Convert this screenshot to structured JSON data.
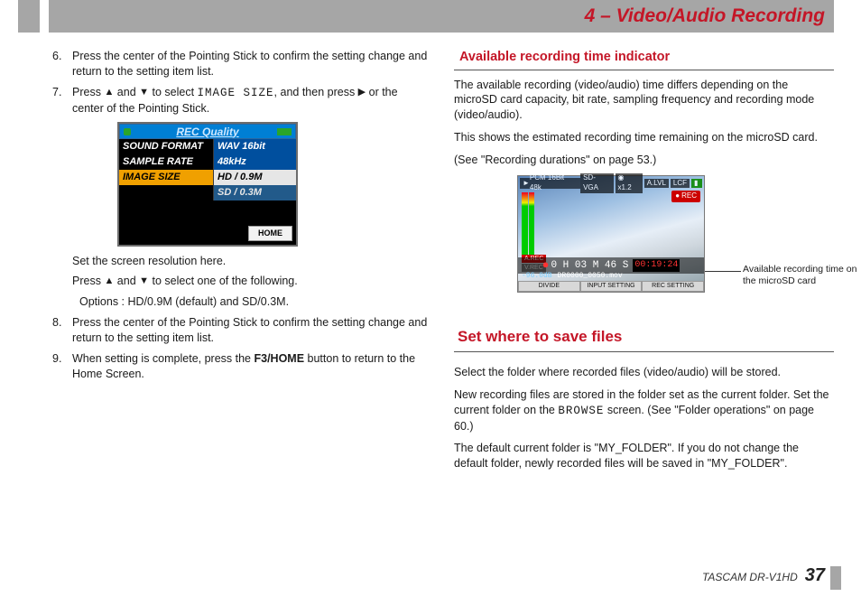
{
  "header": {
    "title": "4 – Video/Audio Recording"
  },
  "left": {
    "steps": {
      "s6": "Press the center of the Pointing Stick to confirm the setting change and return to the setting item list.",
      "s7_a": "Press ",
      "s7_b": " and ",
      "s7_c": " to select ",
      "s7_mono": "IMAGE SIZE",
      "s7_d": ", and then press ",
      "s7_e": " or the center of the Pointing Stick.",
      "s7_sub1": "Set the screen resolution here.",
      "s7_sub2a": "Press ",
      "s7_sub2b": " and ",
      "s7_sub2c": " to select one of the following.",
      "s7_sub3": " Options : HD/0.9M (default) and SD/0.3M.",
      "s8": "Press the center of the Pointing Stick to confirm the setting change and return to the setting item list.",
      "s9_a": "When setting is complete, press the ",
      "s9_btn": "F3/HOME",
      "s9_b": " button to return to the Home Screen."
    },
    "screenshot1": {
      "title": "REC Quality",
      "row1_l": "SOUND FORMAT",
      "row1_r": "WAV 16bit",
      "row2_l": "SAMPLE RATE",
      "row2_r": "48kHz",
      "row3_l": "IMAGE SIZE",
      "row3_r": "HD / 0.9M",
      "row4_r": "SD / 0.3M",
      "home": "HOME"
    }
  },
  "right": {
    "h1": "Available recording time indicator",
    "p1": "The available recording (video/audio) time differs depending on the microSD card capacity, bit rate, sampling frequency and recording mode (video/audio).",
    "p2": "This shows the estimated recording time remaining on the microSD card.",
    "p3": "(See \"Recording durations\" on page 53.)",
    "callout": "Available recording time on the microSD card",
    "screenshot2": {
      "top_l": "PCM 16Bit 48k",
      "top_c": "SD-VGA",
      "top_r1": "x1.2",
      "top_r2": "A.LVL",
      "top_r3": "LCF",
      "rec": "REC",
      "arec": "A.REC",
      "vrec": "V.REC",
      "timer_main": "0 H 03 M 46 S",
      "timer_red": "00:19:24",
      "db": "-96.0dB",
      "fname": "DR0000_0050.mov",
      "btn1": "DIVIDE",
      "btn2": "INPUT SETTING",
      "btn3": "REC SETTING"
    },
    "h2": "Set where to save files",
    "p4": "Select the folder where recorded files (video/audio) will be stored.",
    "p5a": "New recording files are stored in the folder set as the current folder. Set the current folder on the ",
    "p5mono": "BROWSE",
    "p5b": " screen. (See \"Folder operations\" on page 60.)",
    "p6": "The default current folder is \"MY_FOLDER\". If you do not change the default folder, newly recorded files will be saved in \"MY_FOLDER\"."
  },
  "footer": {
    "model": "TASCAM  DR-V1HD",
    "page": "37"
  }
}
